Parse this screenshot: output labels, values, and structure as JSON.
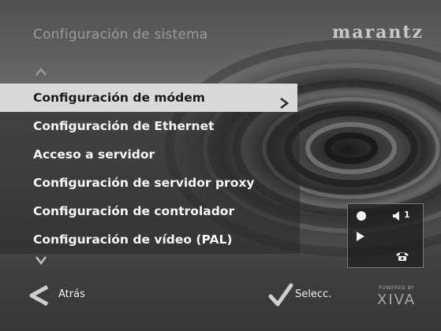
{
  "header": {
    "title": "Configuración de sistema",
    "brand": "marantz"
  },
  "menu": {
    "items": [
      {
        "label": "Configuración de módem",
        "selected": true
      },
      {
        "label": "Configuración de Ethernet",
        "selected": false
      },
      {
        "label": "Acceso a servidor",
        "selected": false
      },
      {
        "label": "Configuración de servidor proxy",
        "selected": false
      },
      {
        "label": "Configuración de controlador",
        "selected": false
      },
      {
        "label": "Configuración de vídeo (PAL)",
        "selected": false
      }
    ]
  },
  "status_panel": {
    "volume_number": "1",
    "icons": [
      "record-dot-icon",
      "speaker-icon",
      "play-icon",
      "telephone-icon"
    ]
  },
  "footer": {
    "back_label": "Atrás",
    "select_label": "Selecc.",
    "logo_sub": "POWERED BY",
    "logo_word": "XIVA"
  },
  "colors": {
    "selected_bg": "#d9d9d9",
    "selected_text": "#1a1a1a",
    "item_text": "#f6f6f6",
    "title_text": "#9a9a9a"
  }
}
